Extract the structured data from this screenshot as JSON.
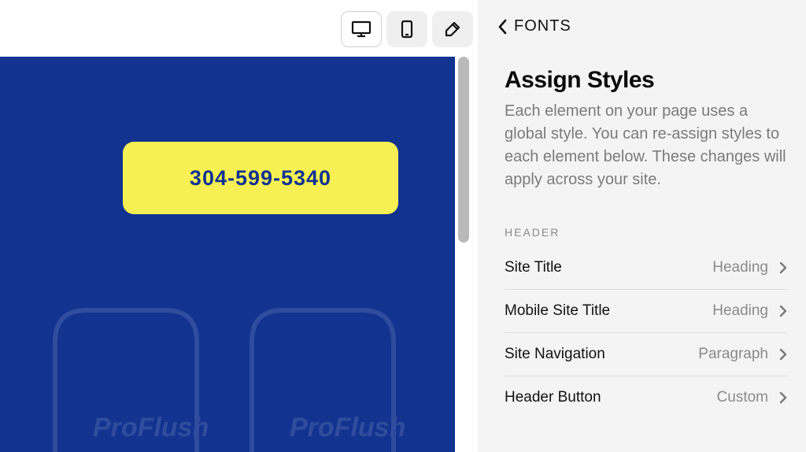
{
  "toolbar": {
    "desktop_icon": "desktop",
    "mobile_icon": "mobile",
    "brush_icon": "brush"
  },
  "canvas": {
    "phone_button_label": "304-599-5340",
    "brand_watermark": "ProFlush"
  },
  "panel": {
    "back_label": "FONTS",
    "title": "Assign Styles",
    "description": "Each element on your page uses a global style. You can re-assign styles to each element below. These changes will apply across your site.",
    "section_header": "HEADER",
    "rows": [
      {
        "label": "Site Title",
        "value": "Heading"
      },
      {
        "label": "Mobile Site Title",
        "value": "Heading"
      },
      {
        "label": "Site Navigation",
        "value": "Paragraph"
      },
      {
        "label": "Header Button",
        "value": "Custom"
      }
    ]
  }
}
